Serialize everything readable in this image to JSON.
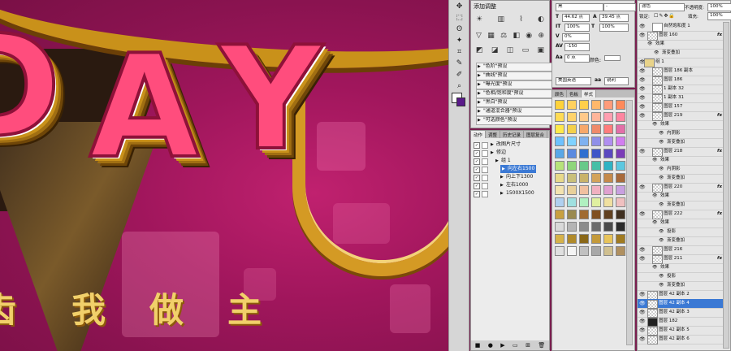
{
  "canvas": {
    "day_letters": [
      "D",
      "A",
      "Y"
    ],
    "caption_chars": [
      "我",
      "做",
      "主"
    ],
    "partial_char": "齿"
  },
  "toolbox": {
    "icons": [
      "move-icon",
      "marquee-icon",
      "lasso-icon",
      "magic-wand-icon",
      "crop-icon",
      "eyedropper-icon",
      "healing-icon",
      "brush-icon",
      "stamp-icon",
      "history-brush-icon",
      "eraser-icon",
      "gradient-icon",
      "blur-icon",
      "dodge-icon",
      "pen-icon",
      "type-icon",
      "path-select-icon",
      "shape-icon",
      "hand-icon",
      "zoom-icon"
    ],
    "fg_color": "#ffffff",
    "bg_color": "#5a1a8a"
  },
  "adjustments": {
    "title": "添加调整",
    "presets": [
      "\"色阶\"预设",
      "\"曲线\"预设",
      "\"曝光度\"预设",
      "\"色相/饱和度\"预设",
      "\"黑白\"预设",
      "\"通道混合器\"预设",
      "\"可选颜色\"预设"
    ]
  },
  "actions": {
    "tabs": [
      "动作",
      "调整",
      "历史记录",
      "图层复合",
      "信息"
    ],
    "rows": [
      {
        "label": "改图片尺寸",
        "indent": 0,
        "checked": true,
        "selected": false
      },
      {
        "label": "修边",
        "indent": 0,
        "checked": true,
        "selected": false
      },
      {
        "label": "组 1",
        "indent": 1,
        "checked": true,
        "selected": false
      },
      {
        "label": "向左右1500",
        "indent": 2,
        "checked": true,
        "selected": true
      },
      {
        "label": "向上下1300",
        "indent": 2,
        "checked": true,
        "selected": false
      },
      {
        "label": "左右1000",
        "indent": 2,
        "checked": true,
        "selected": false
      },
      {
        "label": "1500X1500",
        "indent": 2,
        "checked": true,
        "selected": false
      }
    ]
  },
  "character": {
    "font_family": "黑",
    "font_style": "-",
    "size": "44.62 点",
    "leading": "39.45 点",
    "tracking": "0%",
    "kerning": "-150",
    "vscale": "100%",
    "hscale": "100%",
    "baseline": "0 点",
    "color_label": "颜色:",
    "language": "美国英语",
    "antialias": "锐利"
  },
  "swatches": {
    "tabs": [
      "颜色",
      "色板",
      "样式"
    ],
    "colors": [
      "#ffd23a",
      "#ffd15f",
      "#ffcf4a",
      "#ffb86a",
      "#ff9b7a",
      "#ff8a5b",
      "#ffdb54",
      "#ffd36b",
      "#ffc98a",
      "#ffb59a",
      "#ff9fb0",
      "#ff85a0",
      "#ffe94a",
      "#f3d04a",
      "#f7a86b",
      "#f08a6a",
      "#ff7c7c",
      "#e36fa8",
      "#6ec1ff",
      "#7fd2ff",
      "#7fb1f0",
      "#8f8fe8",
      "#b18ff0",
      "#d27ef0",
      "#59a7e8",
      "#5b8be0",
      "#2f6fd0",
      "#3e56c8",
      "#5a49c0",
      "#7a3cb8",
      "#b7e37a",
      "#8ed67a",
      "#67c98a",
      "#45bfa6",
      "#2fb3c4",
      "#5cc8e0",
      "#e8d98a",
      "#c9c07a",
      "#c9b36a",
      "#d3a35a",
      "#c58a4a",
      "#a86a3a",
      "#f3e3b0",
      "#e8d09a",
      "#f0c0a0",
      "#f0b0c0",
      "#e0a0d0",
      "#c8a0e0",
      "#b0d0f0",
      "#a0e0e0",
      "#b0f0c0",
      "#e0f0a0",
      "#f0e0a0",
      "#f0c0c0",
      "#c8a040",
      "#9a8a50",
      "#a06a30",
      "#805020",
      "#604020",
      "#403020",
      "#d9d9d9",
      "#b5b5b5",
      "#8c8c8c",
      "#6b6b6b",
      "#4a4a4a",
      "#2b2b2b",
      "#d6b24a",
      "#b08a2a",
      "#8a6818",
      "#c49a3a",
      "#e8c45a",
      "#a07a20",
      "#e0e0e0",
      "#f4f4f4",
      "#c0c0c0",
      "#a8a8a8",
      "#d0c090",
      "#b09060"
    ]
  },
  "layers": {
    "blend_mode": "滤色",
    "opacity_label": "不透明度:",
    "opacity": "100%",
    "lock_label": "锁定:",
    "fill_label": "填充:",
    "fill": "100%",
    "rows": [
      {
        "label": "自然饱和度 1",
        "indent": 20,
        "thumb": "white",
        "fx": false,
        "selected": false
      },
      {
        "label": "图层 160",
        "indent": 14,
        "thumb": "check",
        "fx": true,
        "selected": false
      },
      {
        "label": "效果",
        "indent": 22,
        "thumb": "none",
        "fx": false,
        "selected": false
      },
      {
        "label": "渐变叠加",
        "indent": 30,
        "thumb": "none",
        "fx": false,
        "selected": false
      },
      {
        "label": "组 1",
        "indent": 10,
        "thumb": "folder",
        "fx": false,
        "selected": false
      },
      {
        "label": "图层 186 副本",
        "indent": 20,
        "thumb": "check",
        "fx": false,
        "selected": false
      },
      {
        "label": "图层 186",
        "indent": 20,
        "thumb": "check",
        "fx": false,
        "selected": false
      },
      {
        "label": "1 副本 32",
        "indent": 20,
        "thumb": "check",
        "fx": false,
        "selected": false
      },
      {
        "label": "1 副本 31",
        "indent": 20,
        "thumb": "check",
        "fx": false,
        "selected": false
      },
      {
        "label": "图层 157",
        "indent": 20,
        "thumb": "check",
        "fx": false,
        "selected": false
      },
      {
        "label": "图层 219",
        "indent": 20,
        "thumb": "check",
        "fx": true,
        "selected": false
      },
      {
        "label": "效果",
        "indent": 28,
        "thumb": "none",
        "fx": false,
        "selected": false
      },
      {
        "label": "内阴影",
        "indent": 36,
        "thumb": "none",
        "fx": false,
        "selected": false
      },
      {
        "label": "渐变叠加",
        "indent": 36,
        "thumb": "none",
        "fx": false,
        "selected": false
      },
      {
        "label": "图层 218",
        "indent": 20,
        "thumb": "check",
        "fx": true,
        "selected": false
      },
      {
        "label": "效果",
        "indent": 28,
        "thumb": "none",
        "fx": false,
        "selected": false
      },
      {
        "label": "内阴影",
        "indent": 36,
        "thumb": "none",
        "fx": false,
        "selected": false
      },
      {
        "label": "渐变叠加",
        "indent": 36,
        "thumb": "none",
        "fx": false,
        "selected": false
      },
      {
        "label": "图层 220",
        "indent": 20,
        "thumb": "check",
        "fx": true,
        "selected": false
      },
      {
        "label": "效果",
        "indent": 28,
        "thumb": "none",
        "fx": false,
        "selected": false
      },
      {
        "label": "渐变叠加",
        "indent": 36,
        "thumb": "none",
        "fx": false,
        "selected": false
      },
      {
        "label": "图层 222",
        "indent": 20,
        "thumb": "check",
        "fx": true,
        "selected": false
      },
      {
        "label": "效果",
        "indent": 28,
        "thumb": "none",
        "fx": false,
        "selected": false
      },
      {
        "label": "投影",
        "indent": 36,
        "thumb": "none",
        "fx": false,
        "selected": false
      },
      {
        "label": "渐变叠加",
        "indent": 36,
        "thumb": "none",
        "fx": false,
        "selected": false
      },
      {
        "label": "图层 216",
        "indent": 20,
        "thumb": "check",
        "fx": false,
        "selected": false
      },
      {
        "label": "图层 211",
        "indent": 20,
        "thumb": "check",
        "fx": true,
        "selected": false
      },
      {
        "label": "效果",
        "indent": 28,
        "thumb": "none",
        "fx": false,
        "selected": false
      },
      {
        "label": "投影",
        "indent": 36,
        "thumb": "none",
        "fx": false,
        "selected": false
      },
      {
        "label": "渐变叠加",
        "indent": 36,
        "thumb": "none",
        "fx": false,
        "selected": false
      },
      {
        "label": "图层 42 副本 2",
        "indent": 14,
        "thumb": "check",
        "fx": false,
        "selected": false
      },
      {
        "label": "图层 42 副本 4",
        "indent": 14,
        "thumb": "check",
        "fx": false,
        "selected": true
      },
      {
        "label": "图层 42 副本 3",
        "indent": 14,
        "thumb": "check",
        "fx": false,
        "selected": false
      },
      {
        "label": "图层 182",
        "indent": 14,
        "thumb": "dark",
        "fx": false,
        "selected": false
      },
      {
        "label": "图层 42 副本 5",
        "indent": 14,
        "thumb": "check",
        "fx": false,
        "selected": false
      },
      {
        "label": "图层 42 副本 6",
        "indent": 14,
        "thumb": "check",
        "fx": false,
        "selected": false
      }
    ]
  }
}
